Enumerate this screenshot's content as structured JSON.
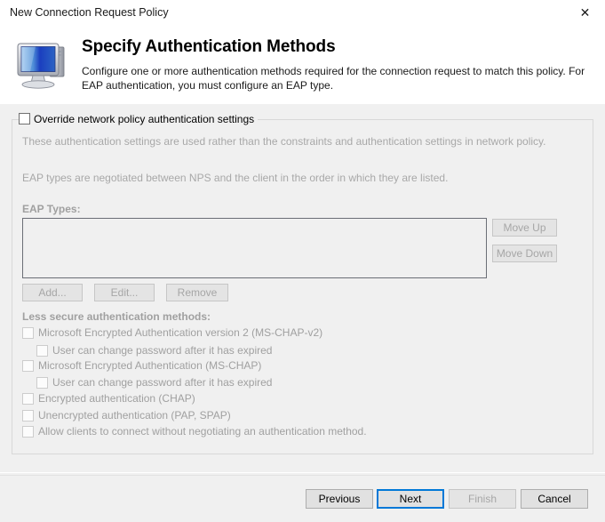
{
  "window": {
    "title": "New Connection Request Policy",
    "close_label": "✕",
    "close_icon": "close-icon"
  },
  "header": {
    "icon": "computer-monitor-icon",
    "title": "Specify Authentication Methods",
    "description": "Configure one or more authentication methods required for the connection request to match this policy. For EAP authentication, you must configure an EAP type."
  },
  "group": {
    "override_checkbox_label": "Override network policy authentication settings",
    "override_checked": false,
    "info_line_1": "These authentication settings are used rather than the constraints and authentication settings in network policy.",
    "info_line_2": "EAP types are negotiated between NPS and the client in the order in which they are listed.",
    "eap_types_label": "EAP Types:",
    "eap_types_items": [],
    "buttons": {
      "add": "Add...",
      "edit": "Edit...",
      "remove": "Remove",
      "move_up": "Move Up",
      "move_down": "Move Down"
    },
    "less_secure_label": "Less secure authentication methods:",
    "methods": [
      {
        "label": "Microsoft Encrypted Authentication version 2 (MS-CHAP-v2)",
        "checked": false,
        "indent": 0
      },
      {
        "label": "User can change password after it has expired",
        "checked": false,
        "indent": 1
      },
      {
        "label": "Microsoft Encrypted Authentication (MS-CHAP)",
        "checked": false,
        "indent": 0
      },
      {
        "label": "User can change password after it has expired",
        "checked": false,
        "indent": 1
      },
      {
        "label": "Encrypted authentication (CHAP)",
        "checked": false,
        "indent": 0
      },
      {
        "label": "Unencrypted authentication (PAP, SPAP)",
        "checked": false,
        "indent": 0
      },
      {
        "label": "Allow clients to connect without negotiating an authentication method.",
        "checked": false,
        "indent": 0
      }
    ]
  },
  "footer": {
    "previous": "Previous",
    "next": "Next",
    "finish": "Finish",
    "cancel": "Cancel"
  },
  "colors": {
    "accent": "#0078d7",
    "window_bg": "#f0f0f0",
    "header_bg": "#ffffff",
    "disabled_text": "#a0a0a0"
  }
}
